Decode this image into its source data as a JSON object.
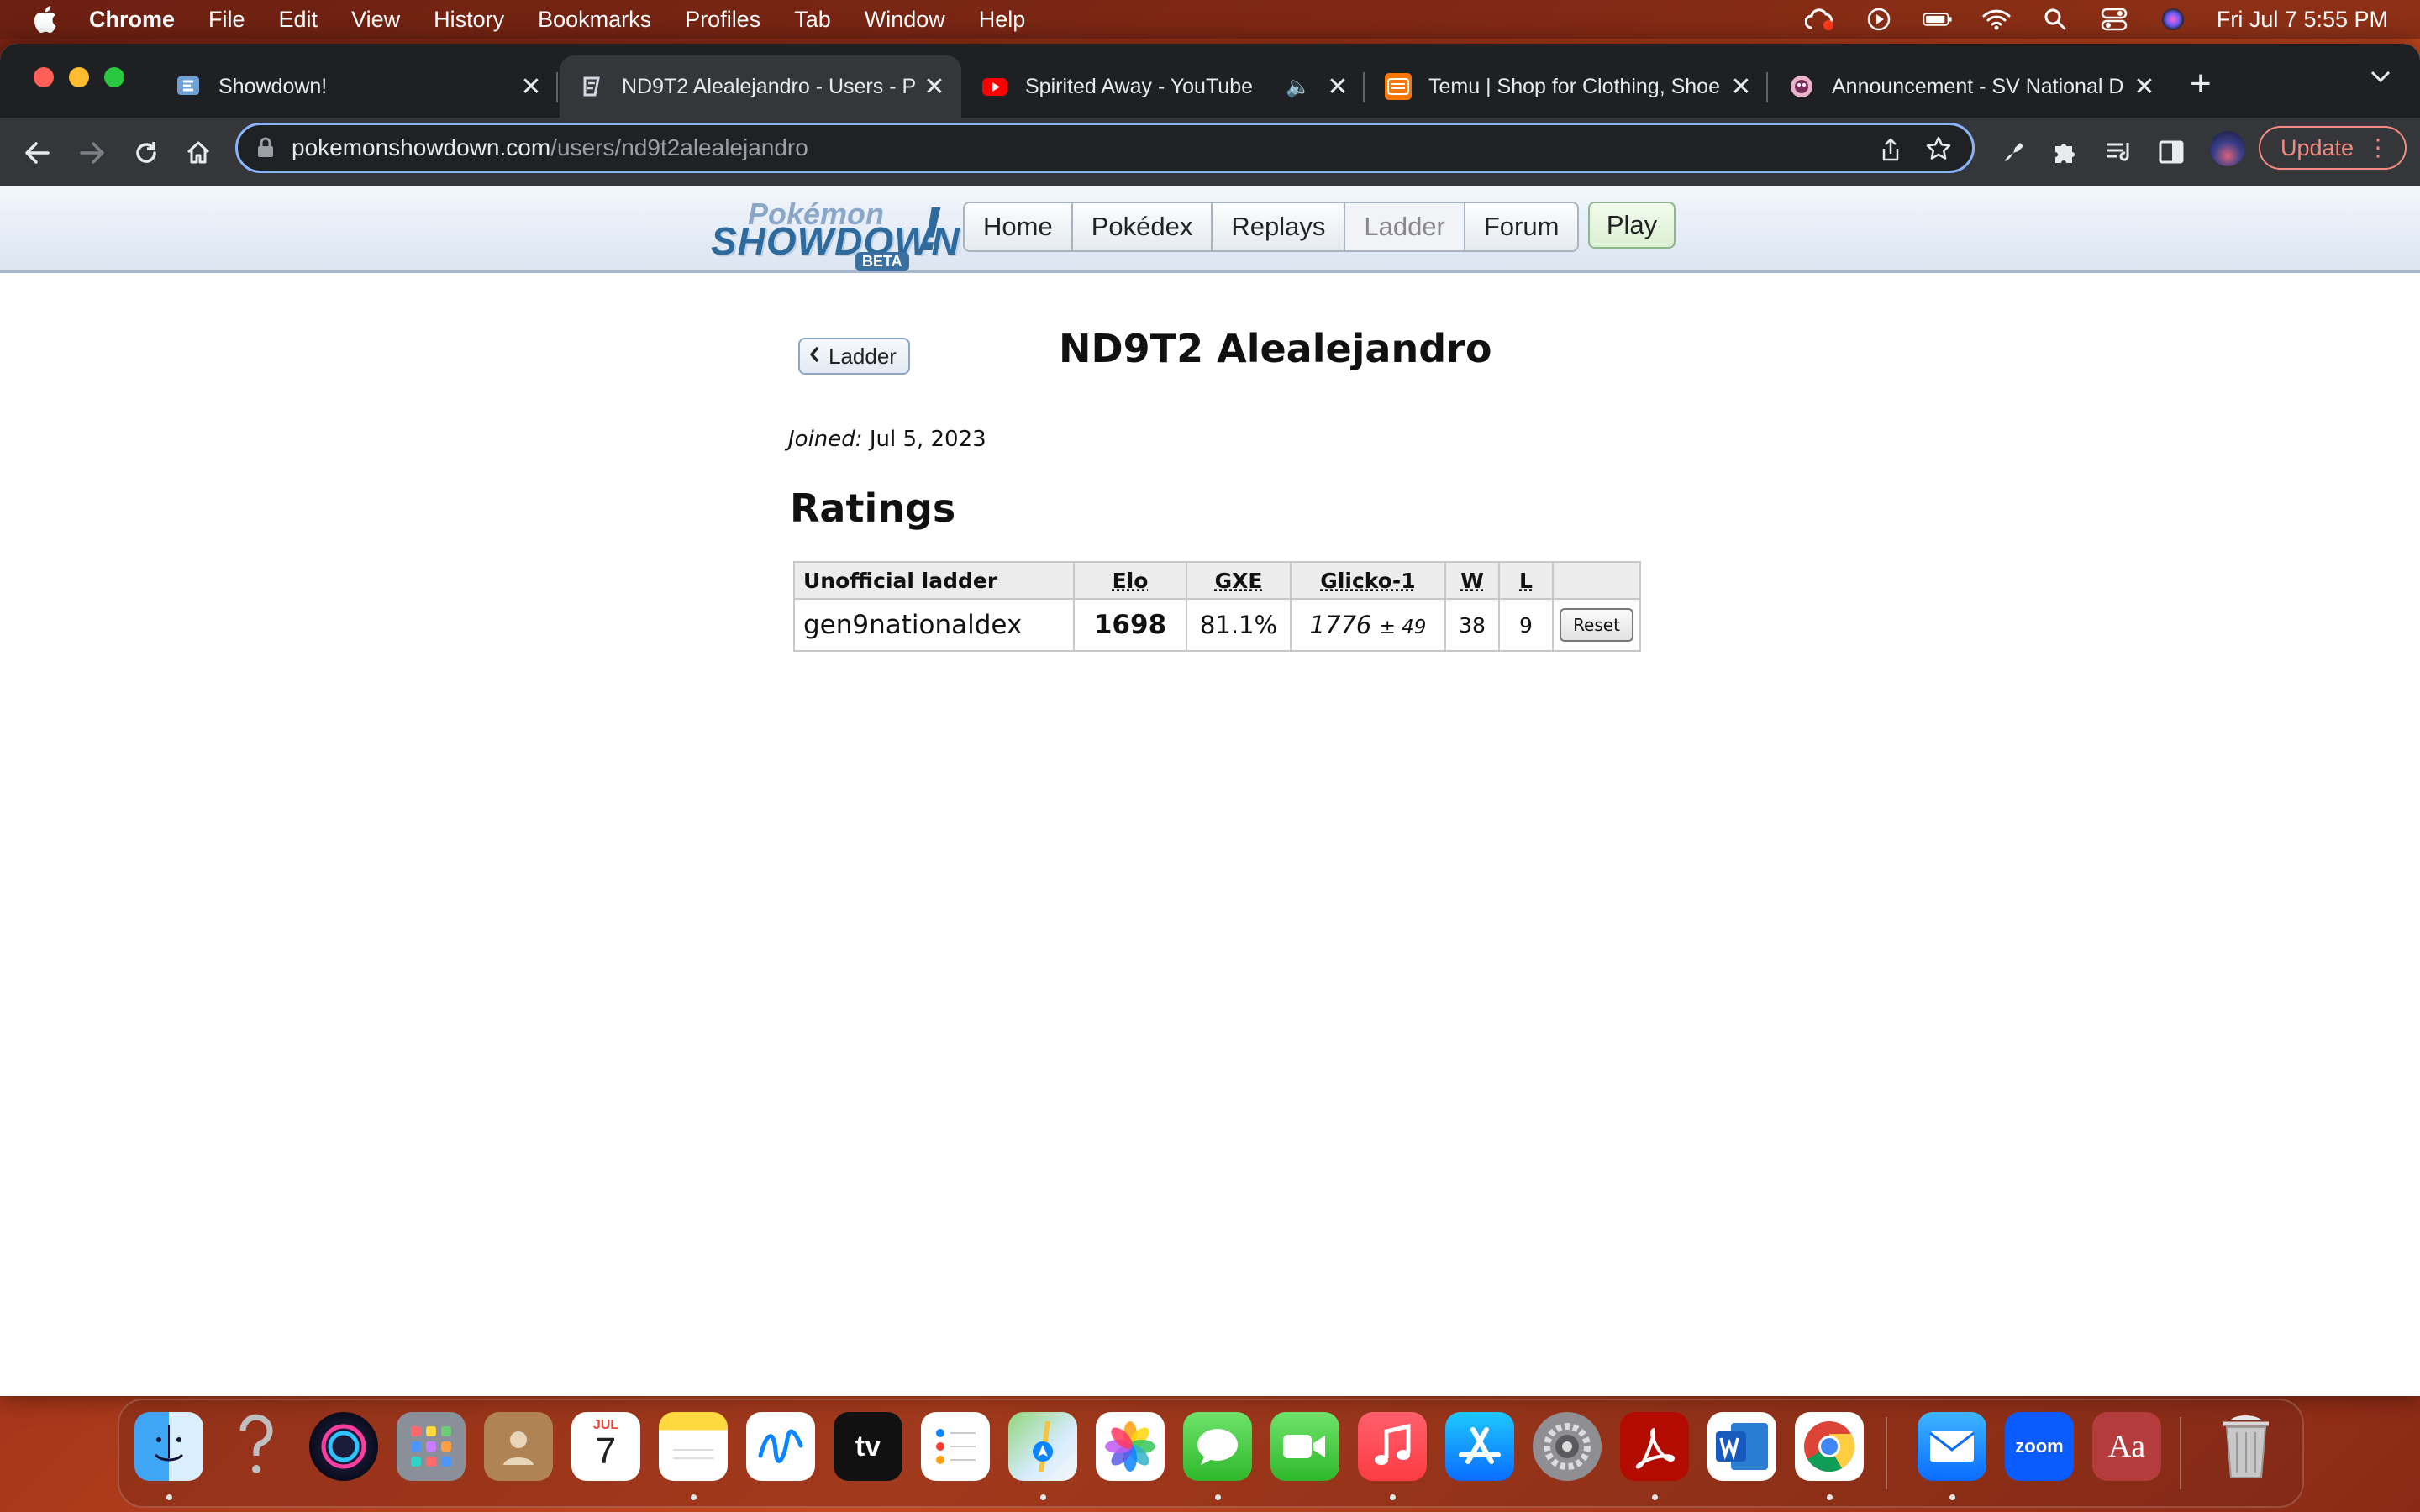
{
  "menubar": {
    "app_name": "Chrome",
    "items": [
      "File",
      "Edit",
      "View",
      "History",
      "Bookmarks",
      "Profiles",
      "Tab",
      "Window",
      "Help"
    ],
    "clock": "Fri Jul 7  5:55 PM"
  },
  "tabs": [
    {
      "title": "Showdown!",
      "favicon": "showdown-icon"
    },
    {
      "title": "ND9T2 Alealejandro - Users - P",
      "favicon": "showdown-icon",
      "active": true
    },
    {
      "title": "Spirited Away - YouTube",
      "favicon": "youtube-icon",
      "audio": true
    },
    {
      "title": "Temu | Shop for Clothing, Shoe",
      "favicon": "temu-icon"
    },
    {
      "title": "Announcement - SV National D",
      "favicon": "smogon-icon"
    }
  ],
  "omnibox": {
    "host": "pokemonshowdown.com",
    "path": "/users/nd9t2alealejandro"
  },
  "toolbar": {
    "update_label": "Update"
  },
  "site": {
    "logo_top": "Pokémon",
    "logo_main": "SHOWDOWN",
    "logo_badge": "BETA",
    "logo_bang": "!",
    "nav": [
      "Home",
      "Pokédex",
      "Replays",
      "Ladder",
      "Forum"
    ],
    "current_nav": "Ladder",
    "play_label": "Play"
  },
  "profile": {
    "back_label": "Ladder",
    "username": "ND9T2 Alealejandro",
    "joined_label": "Joined:",
    "joined_date": "Jul 5, 2023",
    "ratings_heading": "Ratings"
  },
  "ratings_table": {
    "headers": [
      "Unofficial ladder",
      "Elo",
      "GXE",
      "Glicko-1",
      "W",
      "L",
      ""
    ],
    "rows": [
      {
        "format": "gen9nationaldex",
        "elo": "1698",
        "gxe": "81.1%",
        "glicko": "1776",
        "glicko_dev": "± 49",
        "w": "38",
        "l": "9",
        "action": "Reset"
      }
    ]
  },
  "dock": {
    "calendar_month": "JUL",
    "calendar_day": "7",
    "tv_label": "tv",
    "zoom_label": "zoom",
    "dictionary_label": "Aa"
  }
}
